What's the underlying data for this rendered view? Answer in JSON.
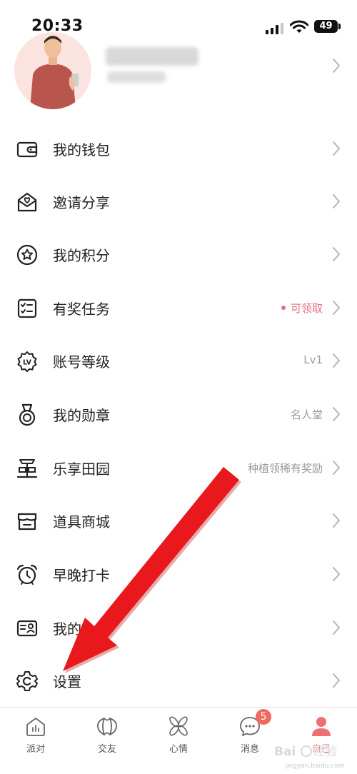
{
  "status": {
    "time": "20:33",
    "battery": "49"
  },
  "menu": [
    {
      "label": "我的钱包",
      "extra": "",
      "icon": "wallet-icon"
    },
    {
      "label": "邀请分享",
      "extra": "",
      "icon": "invite-envelope-icon"
    },
    {
      "label": "我的积分",
      "extra": "",
      "icon": "points-star-icon"
    },
    {
      "label": "有奖任务",
      "extra": "可领取",
      "icon": "task-checklist-icon"
    },
    {
      "label": "账号等级",
      "extra": "Lv1",
      "icon": "level-badge-icon"
    },
    {
      "label": "我的勋章",
      "extra": "名人堂",
      "icon": "medal-icon"
    },
    {
      "label": "乐享田园",
      "extra": "种植领稀有奖励",
      "icon": "garden-icon"
    },
    {
      "label": "道具商城",
      "extra": "",
      "icon": "store-icon"
    },
    {
      "label": "早晚打卡",
      "extra": "",
      "icon": "alarm-clock-icon"
    },
    {
      "label": "我的",
      "extra": "",
      "icon": "id-card-icon"
    },
    {
      "label": "设置",
      "extra": "",
      "icon": "settings-gear-icon"
    }
  ],
  "tabs": [
    {
      "label": "派对",
      "icon": "party-house-icon"
    },
    {
      "label": "交友",
      "icon": "friends-icon"
    },
    {
      "label": "心情",
      "icon": "mood-flower-icon"
    },
    {
      "label": "消息",
      "icon": "message-bubble-icon",
      "badge": "5"
    },
    {
      "label": "自己",
      "icon": "profile-person-icon"
    }
  ],
  "watermark": {
    "text": "jingyan.baidu.com"
  },
  "colors": {
    "accent": "#e06f7c",
    "arrow": "#e8181d",
    "active_tab": "#ef6f74"
  }
}
